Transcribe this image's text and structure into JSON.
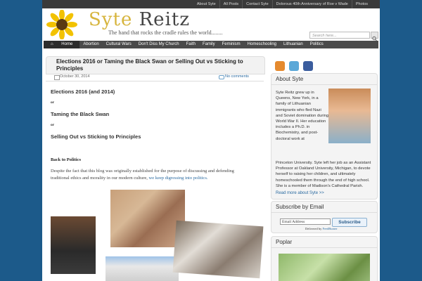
{
  "topnav": [
    "About Syte",
    "All Posts",
    "Contact Syte",
    "Dolorous 40th Anniversary of Roe v Wade",
    "Photos"
  ],
  "logo": {
    "first": "Syte",
    "second": "Reitz"
  },
  "tagline": "The hand that rocks the cradle rules the world........",
  "search": {
    "placeholder": "Search here..."
  },
  "mainnav": [
    "Home",
    "Abortion",
    "Cultural Wars",
    "Don't Diss My Church",
    "Faith",
    "Family",
    "Feminism",
    "Homeschooling",
    "Lithuanian",
    "Politics"
  ],
  "post": {
    "title": "Elections 2016 or Taming the Black Swan or Selling Out vs Sticking to Principles",
    "date": "October 30, 2014",
    "comments": "No comments",
    "h1": "Elections 2016 (and 2014)",
    "or1": "or",
    "h2": "Taming the Black Swan",
    "or2": "or",
    "h3": "Selling Out vs Sticking to Principles",
    "subhead": "Back to Politics",
    "para": "Despite the fact that this blog was originally established for the purpose of discussing and defending traditional ethics and morality in our modern culture,",
    "link": "we keep digressing into politics."
  },
  "sidebar": {
    "about_head": "About Syte",
    "about_text": "Syte Reitz grew up in Queens, New York, in a family of Lithuanian immigrants who fled Nazi and Soviet domination during World War II. Her education includes a Ph.D. in Biochemistry, and post-doctoral work at",
    "about_cont": "Princeton University. Syte left her job as an Assistant Professor at Oakland University, Michigan, to devote herself to raising her children, and ultimately homeschooled them through the end of high school. She is a member of Madison's Cathedral Parish.",
    "readmore": "Read more about Syte >>",
    "subscribe_head": "Subscribe by Email",
    "email_placeholder": "Email Address",
    "subscribe_btn": "Subscribe",
    "delivered": "Delivered by",
    "feedburner": "FeedBurner",
    "popular_head": "Poplar"
  }
}
